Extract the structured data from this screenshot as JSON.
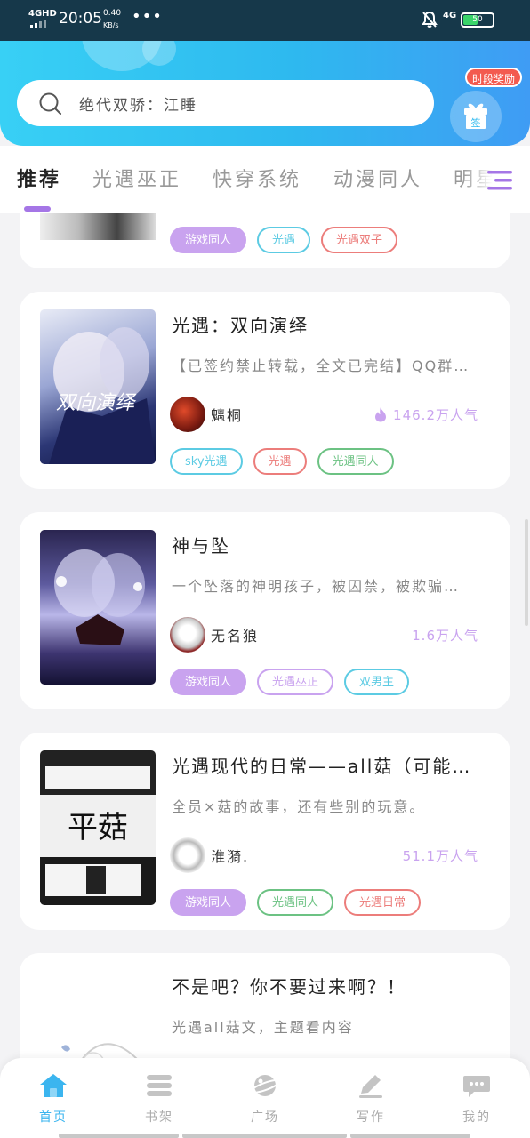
{
  "status_bar": {
    "network": "4GHD",
    "time": "20:05",
    "speed_value": "0.40",
    "speed_unit": "KB/s",
    "dots": "•••",
    "mobile": "4G",
    "battery": "50",
    "battery_level": 0.5
  },
  "search": {
    "placeholder": "绝代双骄：江睡"
  },
  "checkin": {
    "badge": "时段奖励",
    "label": "签"
  },
  "tabs": [
    {
      "label": "推荐"
    },
    {
      "label": "光遇巫正"
    },
    {
      "label": "快穿系统"
    },
    {
      "label": "动漫同人"
    },
    {
      "label": "明星"
    }
  ],
  "partial_card": {
    "tags": [
      "游戏同人",
      "光遇",
      "光遇双子"
    ]
  },
  "books": [
    {
      "title": "光遇：双向演绎",
      "desc": "【已签约禁止转载，全文已完结】QQ群…",
      "author": "魑桐",
      "popularity": "146.2万人气",
      "tags": [
        "sky光遇",
        "光遇",
        "光遇同人"
      ],
      "cover_text": "双向演绎"
    },
    {
      "title": "神与坠",
      "desc": "一个坠落的神明孩子，被囚禁，被欺骗…",
      "author": "无名狼",
      "popularity": "1.6万人气",
      "tags": [
        "游戏同人",
        "光遇巫正",
        "双男主"
      ]
    },
    {
      "title": "光遇现代的日常——all菇（可能…",
      "desc": "全员×菇的故事，还有些别的玩意。",
      "author": "淮漪.",
      "popularity": "51.1万人气",
      "tags": [
        "游戏同人",
        "光遇同人",
        "光遇日常"
      ],
      "cover_text": "平菇"
    },
    {
      "title": "不是吧？你不要过来啊？！",
      "desc": "光遇all菇文，主题看内容"
    }
  ],
  "bottom_nav": [
    {
      "label": "首页",
      "icon": "home-icon"
    },
    {
      "label": "书架",
      "icon": "bookshelf-icon"
    },
    {
      "label": "广场",
      "icon": "planet-icon"
    },
    {
      "label": "写作",
      "icon": "pen-icon"
    },
    {
      "label": "我的",
      "icon": "chat-icon"
    }
  ],
  "colors": {
    "accent_blue": "#3bb5ef",
    "accent_purple": "#a576e6",
    "tag_purple": "#c9a3ef",
    "tag_cyan": "#5ccbe3",
    "tag_red": "#ec7d7b",
    "tag_green": "#6cc283"
  }
}
